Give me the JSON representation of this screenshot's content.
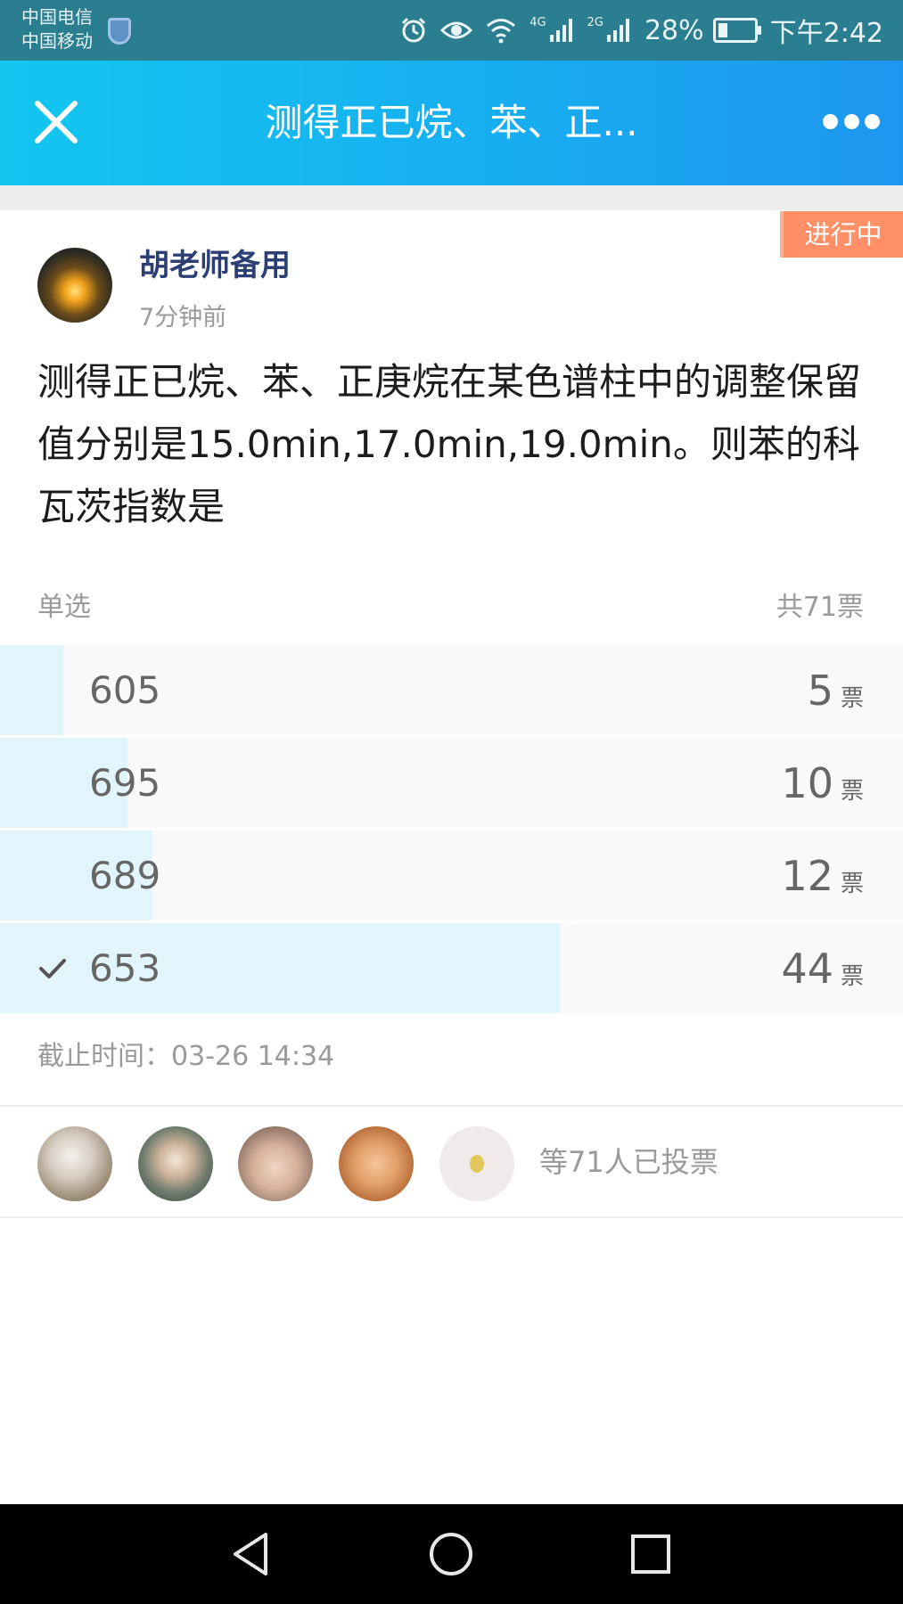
{
  "status_bar": {
    "carrier_1": "中国电信",
    "carrier_2": "中国移动",
    "network_1": "4G",
    "network_2": "2G",
    "battery": "28%",
    "battery_level": 0.28,
    "time": "下午2:42"
  },
  "title_bar": {
    "title": "测得正已烷、苯、正..."
  },
  "post": {
    "status_tag": "进行中",
    "author": "胡老师备用",
    "time_ago": "7分钟前",
    "question": "测得正已烷、苯、正庚烷在某色谱柱中的调整保留值分别是15.0min,17.0min,19.0min。则苯的科瓦茨指数是"
  },
  "poll": {
    "type": "单选",
    "total": "共71票",
    "unit": "票",
    "options": [
      {
        "label": "605",
        "votes": "5",
        "selected": false,
        "share": 0.0704
      },
      {
        "label": "695",
        "votes": "10",
        "selected": false,
        "share": 0.1408
      },
      {
        "label": "689",
        "votes": "12",
        "selected": false,
        "share": 0.169
      },
      {
        "label": "653",
        "votes": "44",
        "selected": true,
        "share": 0.6197
      }
    ],
    "deadline": "截止时间：03-26 14:34",
    "voters_text": "等71人已投票"
  },
  "colors": {
    "status_bar_bg": "#2a7e8f",
    "title_gradient_start": "#13c6f0",
    "title_gradient_end": "#1d96ef",
    "status_tag_bg": "#ff8f66",
    "author_name": "#2c3f74",
    "option_fill": "#e2f5fc",
    "option_bg": "#f9f9f9"
  },
  "icons": {
    "close": "close-icon",
    "more": "more-icon",
    "check": "check-icon",
    "nav_back": "back-triangle-icon",
    "nav_home": "home-circle-icon",
    "nav_recents": "recents-square-icon"
  }
}
